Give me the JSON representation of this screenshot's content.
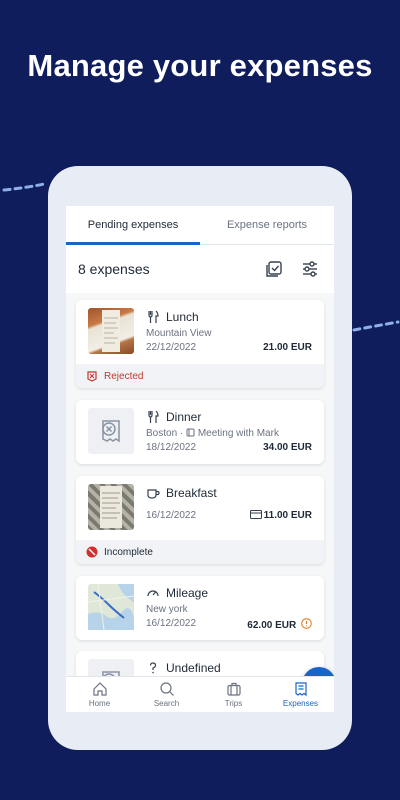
{
  "headline": "Manage your expenses",
  "colors": {
    "background": "#0f1d5c",
    "accent": "#1a63c8",
    "rejected": "#c0392b"
  },
  "tabs": [
    {
      "label": "Pending expenses",
      "active": true
    },
    {
      "label": "Expense reports",
      "active": false
    }
  ],
  "summary": {
    "count": "8 expenses",
    "icons": [
      "select-all-icon",
      "filter-icon"
    ]
  },
  "expenses": [
    {
      "title": "Lunch",
      "icon": "fork-knife-icon",
      "subtitle": "Mountain View",
      "date": "22/12/2022",
      "amount": "21.00 EUR",
      "status": "Rejected",
      "status_icon": "rejected-icon",
      "thumb": "receipt-photo"
    },
    {
      "title": "Dinner",
      "icon": "fork-knife-icon",
      "subtitle": "Boston",
      "project": "Meeting with Mark",
      "date": "18/12/2022",
      "amount": "34.00 EUR",
      "thumb": "no-receipt-icon"
    },
    {
      "title": "Breakfast",
      "icon": "coffee-cup-icon",
      "date": "16/12/2022",
      "amount": "11.00 EUR",
      "payment_icon": "card-icon",
      "status": "Incomplete",
      "status_icon": "incomplete-icon",
      "thumb": "receipt-photo"
    },
    {
      "title": "Mileage",
      "icon": "speedometer-icon",
      "subtitle": "New york",
      "date": "16/12/2022",
      "amount": "62.00 EUR",
      "info_icon": "info-icon",
      "thumb": "map-thumbnail"
    },
    {
      "title": "Undefined",
      "icon": "question-icon",
      "thumb": "no-receipt-icon"
    }
  ],
  "fab": {
    "icon": "plus-icon"
  },
  "nav": [
    {
      "label": "Home",
      "icon": "home-icon",
      "active": false
    },
    {
      "label": "Search",
      "icon": "search-icon",
      "active": false
    },
    {
      "label": "Trips",
      "icon": "suitcase-icon",
      "active": false
    },
    {
      "label": "Expenses",
      "icon": "receipt-icon",
      "active": true
    }
  ]
}
